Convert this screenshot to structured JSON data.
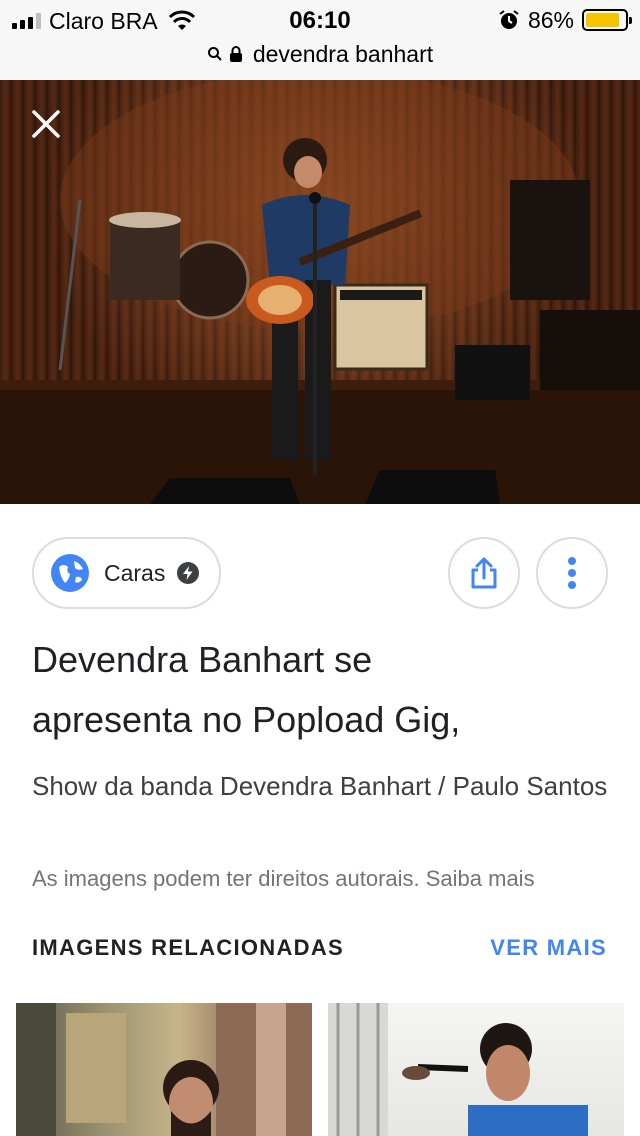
{
  "status_bar": {
    "carrier": "Claro BRA",
    "time": "06:10",
    "battery_percent": "86%",
    "battery_level": 0.86,
    "url": "devendra banhart"
  },
  "hero": {
    "close_icon": "close-icon"
  },
  "source": {
    "name": "Caras",
    "icon": "globe-icon",
    "badge_icon": "bolt-icon"
  },
  "actions": {
    "share_icon": "share-icon",
    "more_icon": "more-vert-icon"
  },
  "content": {
    "title_line1": "Devendra Banhart se",
    "title_line2": "apresenta no Popload Gig,",
    "subtitle": "Show da banda Devendra Banhart / Paulo Santos",
    "copyright": "As imagens podem ter direitos autorais. Saiba mais"
  },
  "related": {
    "heading": "IMAGENS RELACIONADAS",
    "see_more": "VER MAIS"
  },
  "colors": {
    "accent": "#4285f4",
    "battery": "#f7c500"
  }
}
